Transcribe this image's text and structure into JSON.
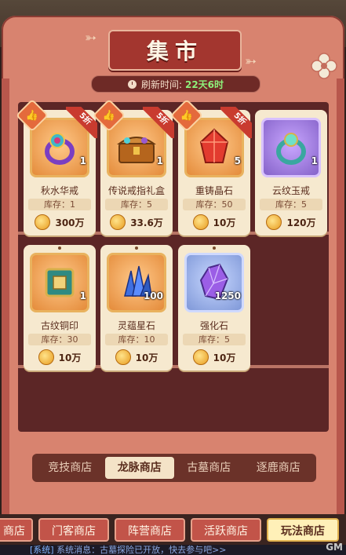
{
  "title": "集市",
  "refresh": {
    "label": "刷新时间:",
    "value": "22天6时"
  },
  "items": [
    {
      "name": "秋水华戒",
      "qty": "1",
      "stock": "库存：1",
      "price": "300万",
      "discount": "5折",
      "hot": true,
      "color": "orange"
    },
    {
      "name": "传说戒指礼盒",
      "qty": "1",
      "stock": "库存：5",
      "price": "33.6万",
      "discount": "5折",
      "hot": true,
      "color": "orange"
    },
    {
      "name": "重铸晶石",
      "qty": "5",
      "stock": "库存：50",
      "price": "10万",
      "discount": "5折",
      "hot": true,
      "color": "orange"
    },
    {
      "name": "云纹玉戒",
      "qty": "1",
      "stock": "库存：5",
      "price": "120万",
      "discount": "",
      "hot": false,
      "color": "purple"
    },
    {
      "name": "古纹铜印",
      "qty": "1",
      "stock": "库存：30",
      "price": "10万",
      "discount": "",
      "hot": false,
      "color": "orange"
    },
    {
      "name": "灵蕴星石",
      "qty": "100",
      "stock": "库存：10",
      "price": "10万",
      "discount": "",
      "hot": false,
      "color": "orange"
    },
    {
      "name": "强化石",
      "qty": "1250",
      "stock": "库存：5",
      "price": "10万",
      "discount": "",
      "hot": false,
      "color": "blue"
    }
  ],
  "tabs": [
    "竞技商店",
    "龙脉商店",
    "古墓商店",
    "逐鹿商店"
  ],
  "active_tab": "龙脉商店",
  "stores": [
    "商店",
    "门客商店",
    "阵营商店",
    "活跃商店",
    "玩法商店"
  ],
  "active_store": "玩法商店",
  "system_msg": {
    "tag": "[系统]",
    "text": "系统消息：古墓探险已开放，快去参与吧>>"
  },
  "gm_label": "GM"
}
